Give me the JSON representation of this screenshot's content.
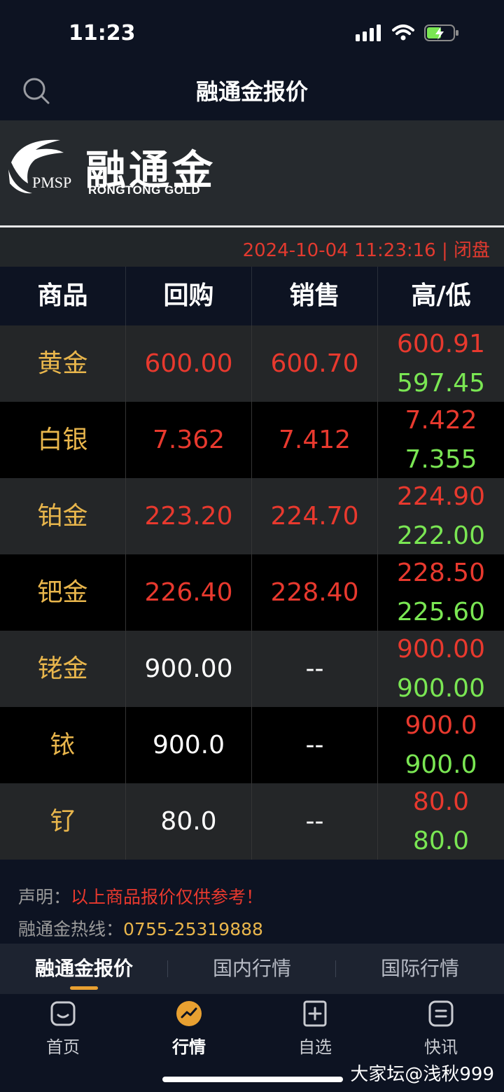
{
  "status": {
    "time": "11:23"
  },
  "nav": {
    "title": "融通金报价"
  },
  "banner": {
    "pmsp": "PMSP",
    "name_cn": "融通金",
    "name_en": "RONGTONG  GOLD"
  },
  "timebar": {
    "text": "2024-10-04 11:23:16 | 闭盘"
  },
  "table": {
    "headers": [
      "商品",
      "回购",
      "销售",
      "高/低"
    ],
    "rows": [
      {
        "name": "黄金",
        "buy": "600.00",
        "sell": "600.70",
        "high": "600.91",
        "low": "597.45"
      },
      {
        "name": "白银",
        "buy": "7.362",
        "sell": "7.412",
        "high": "7.422",
        "low": "7.355"
      },
      {
        "name": "铂金",
        "buy": "223.20",
        "sell": "224.70",
        "high": "224.90",
        "low": "222.00"
      },
      {
        "name": "钯金",
        "buy": "226.40",
        "sell": "228.40",
        "high": "228.50",
        "low": "225.60"
      },
      {
        "name": "铑金",
        "buy": "900.00",
        "sell": "--",
        "high": "900.00",
        "low": "900.00"
      },
      {
        "name": "铱",
        "buy": "900.0",
        "sell": "--",
        "high": "900.0",
        "low": "900.0"
      },
      {
        "name": "钌",
        "buy": "80.0",
        "sell": "--",
        "high": "80.0",
        "low": "80.0"
      }
    ]
  },
  "notes": {
    "disclaimer_label": "声明：",
    "disclaimer_text": "以上商品报价仅供参考！",
    "hotline_label": "融通金热线：",
    "hotline_number": "0755-25319888"
  },
  "subtabs": [
    "融通金报价",
    "国内行情",
    "国际行情"
  ],
  "bottom_nav": [
    "首页",
    "行情",
    "自选",
    "快讯"
  ],
  "watermark": "大家坛@浅秋999",
  "colors": {
    "red": "#e8392e",
    "green": "#7ae653",
    "gold": "#e9b64c",
    "accent": "#e8a031"
  }
}
